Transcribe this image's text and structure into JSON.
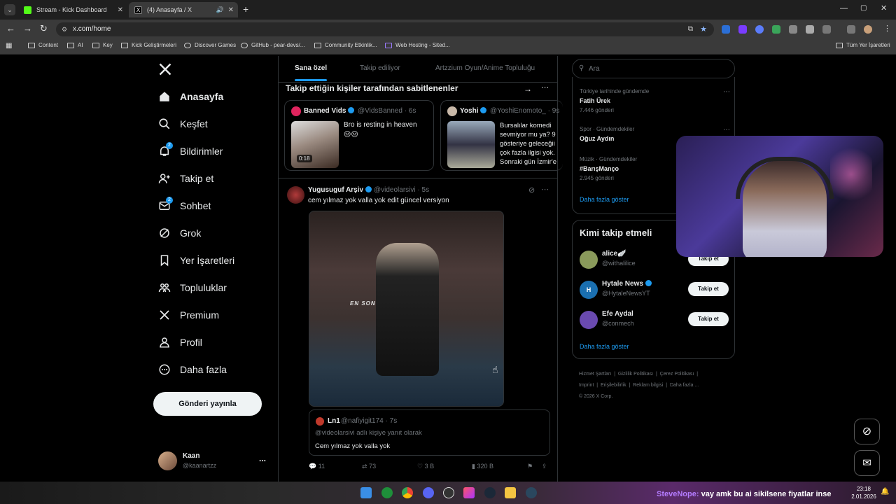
{
  "browser": {
    "tabs": [
      {
        "title": "Stream - Kick Dashboard",
        "active": false
      },
      {
        "title": "(4) Anasayfa / X",
        "active": true
      }
    ],
    "url": "x.com/home",
    "bookmarks": [
      "Content",
      "AI",
      "Key",
      "Kick Geliştirmeleri",
      "Discover Games",
      "GitHub - pear-devs/...",
      "Community Etkinlik...",
      "Web Hosting - Sited..."
    ],
    "bookmarks_right": "Tüm Yer İşaretleri"
  },
  "nav": {
    "items": [
      {
        "label": "Anasayfa",
        "icon": "home-icon",
        "active": true
      },
      {
        "label": "Keşfet",
        "icon": "search-icon"
      },
      {
        "label": "Bildirimler",
        "icon": "bell-icon",
        "badge": "2"
      },
      {
        "label": "Takip et",
        "icon": "person-add-icon"
      },
      {
        "label": "Sohbet",
        "icon": "mail-icon",
        "badge": "2"
      },
      {
        "label": "Grok",
        "icon": "grok-icon"
      },
      {
        "label": "Yer İşaretleri",
        "icon": "bookmark-icon"
      },
      {
        "label": "Topluluklar",
        "icon": "communities-icon"
      },
      {
        "label": "Premium",
        "icon": "x-logo-icon"
      },
      {
        "label": "Profil",
        "icon": "person-icon"
      },
      {
        "label": "Daha fazla",
        "icon": "more-circle-icon"
      }
    ],
    "post_button": "Gönderi yayınla",
    "account": {
      "name": "Kaan",
      "handle": "@kaanartzz",
      "more": "..."
    }
  },
  "feed": {
    "tabs": [
      "Sana özel",
      "Takip ediliyor",
      "Artzzium Oyun/Anime Topluluğu"
    ],
    "pinned_title": "Takip ettiğin kişiler tarafından sabitlenenler",
    "pinned": [
      {
        "name": "Banned Vids",
        "handle": "@VidsBanned",
        "time": "· 6s",
        "text": "Bro is resting in heaven",
        "emoji": "😑😑",
        "duration": "0:18"
      },
      {
        "name": "Yoshi",
        "handle": "@YoshiEnomoto_",
        "time": "· 9s",
        "lines": [
          "Bursalılar komedi",
          "sevmiyor mu ya? 9",
          "gösteriye geleceğii",
          "çok fazla ilgisi yok.",
          "Sonraki gün İzmir'e"
        ]
      }
    ],
    "post": {
      "name": "Yugusuguf Arşiv",
      "handle": "@videolarsivi",
      "time": "· 5s",
      "text": "cem yılmaz yok valla yok edit güncel versiyon",
      "video_caption": "EN SON",
      "quote": {
        "name": "Ln1",
        "handle": "@nafiyigit174",
        "time": "· 7s",
        "reply_to": "@videolarsivi adlı kişiye yanıt olarak",
        "text": "Cem yılmaz yok valla yok"
      },
      "stats": {
        "replies": "11",
        "reposts": "73",
        "likes": "3 B",
        "views": "320 B"
      }
    }
  },
  "right": {
    "search_placeholder": "Ara",
    "trends": [
      {
        "category": "Türkiye tarihinde gündemde",
        "name": "Fatih Ürek",
        "count": "7.446 gönderi"
      },
      {
        "category": "Spor · Gündemdekiler",
        "name": "Oğuz Aydın",
        "count": ""
      },
      {
        "category": "Müzik · Gündemdekiler",
        "name": "#BarışManço",
        "count": "2.945 gönderi"
      }
    ],
    "show_more": "Daha fazla göster",
    "who_to_follow_title": "Kimi takip etmeli",
    "who_to_follow": [
      {
        "name": "alice🪽",
        "handle": "@withalilice",
        "button": "Takip et",
        "color": "#8a9a5b"
      },
      {
        "name": "Hytale News",
        "handle": "@HytaleNewsYT",
        "button": "Takip et",
        "color": "#1a6fb0"
      },
      {
        "name": "Efe Aydal",
        "handle": "@conmech",
        "button": "Takip et",
        "color": "#6a4ab0"
      }
    ],
    "show_more2": "Daha fazla göster",
    "footer_row1": [
      "Hizmet Şartları",
      "|",
      "Gizlilik Politikası",
      "|",
      "Çerez Politikası",
      "|"
    ],
    "footer_row2": [
      "Imprint",
      "|",
      "Erişilebilirlik",
      "|",
      "Reklam bilgisi",
      "|",
      "Daha fazla ..."
    ],
    "copyright": "© 2026 X Corp."
  },
  "overlay": {
    "chat_user": "SteveNope:",
    "chat_text": "vay amk bu ai sikilsene fiyatlar inse"
  },
  "taskbar": {
    "time": "23:18",
    "date": "2.01.2026"
  },
  "colors": {
    "accent": "#1d9bf0",
    "background": "#000000",
    "border": "#2f3336"
  }
}
